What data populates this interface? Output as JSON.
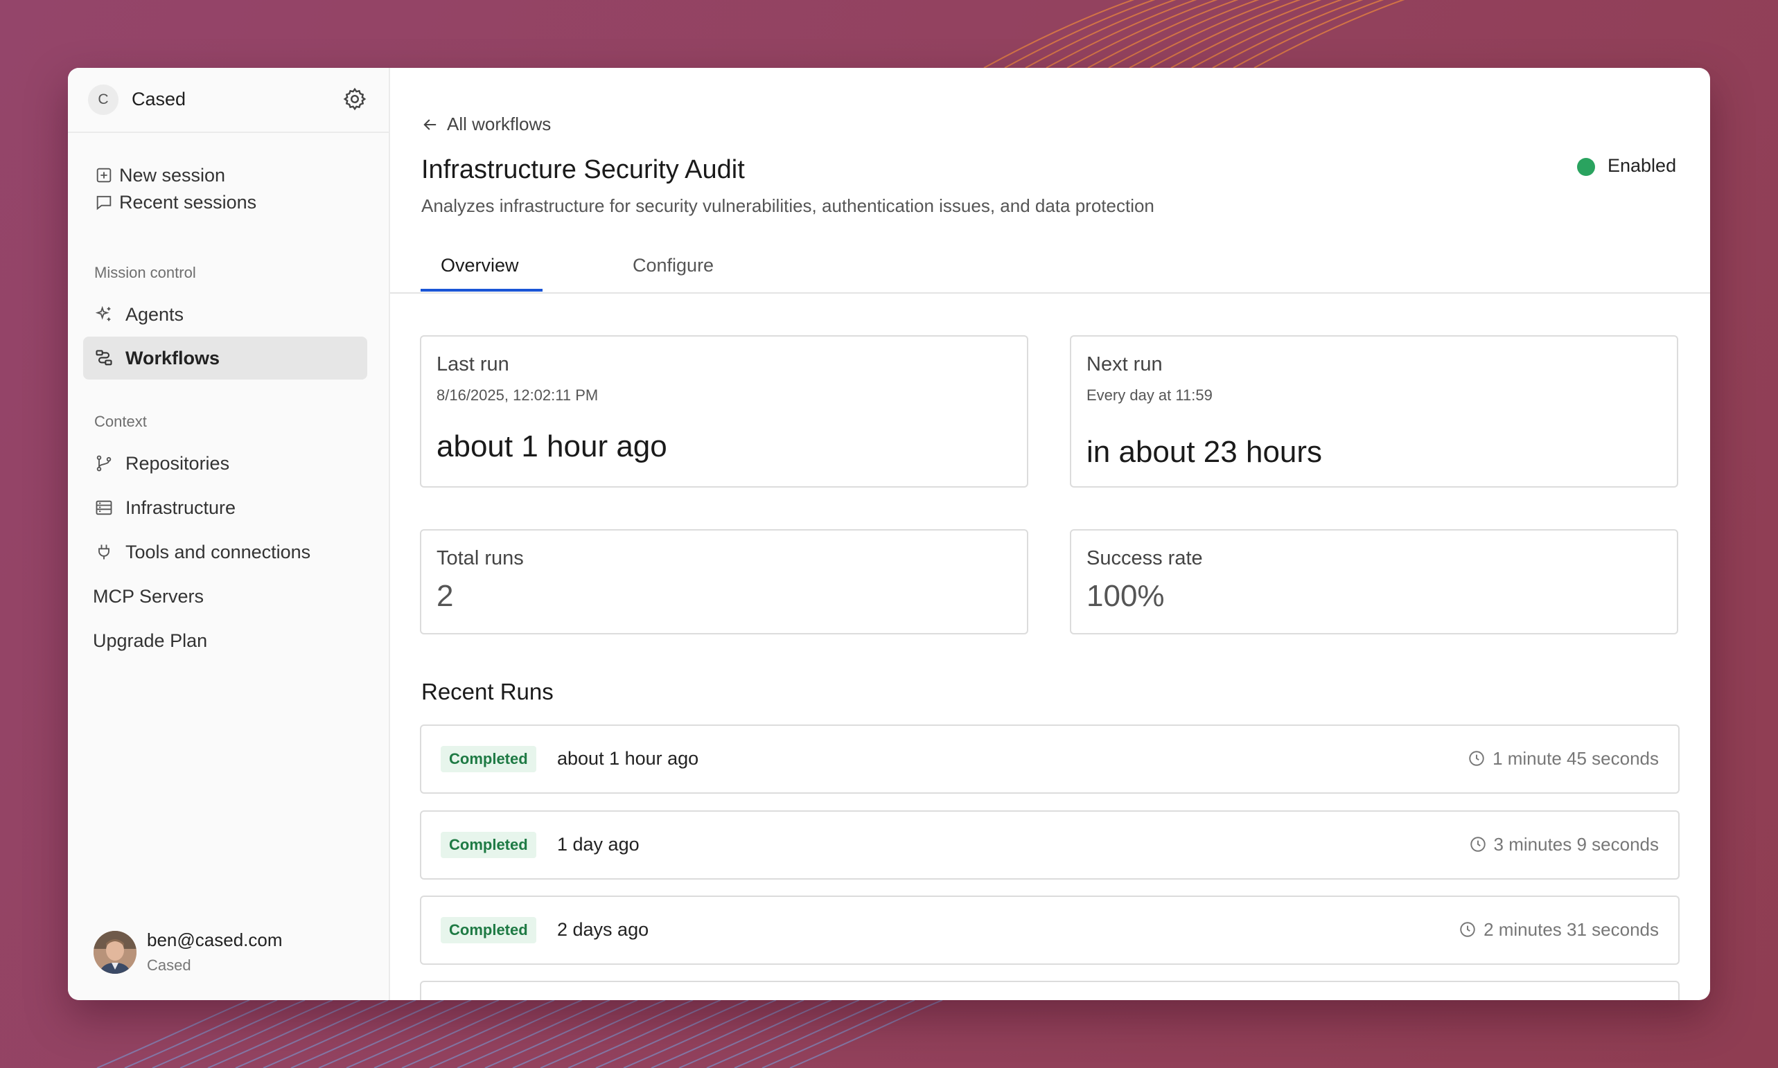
{
  "sidebar": {
    "org_initial": "C",
    "org_name": "Cased",
    "items": [
      {
        "label": "New session",
        "icon": "plus-square-icon"
      },
      {
        "label": "Recent sessions",
        "icon": "chat-bubble-icon"
      },
      {
        "label": "Agents",
        "icon": "sparkles-icon"
      },
      {
        "label": "Workflows",
        "icon": "workflow-icon"
      },
      {
        "label": "Repositories",
        "icon": "git-branch-icon"
      },
      {
        "label": "Infrastructure",
        "icon": "server-icon"
      },
      {
        "label": "Tools and connections",
        "icon": "plug-icon"
      },
      {
        "label": "MCP Servers"
      },
      {
        "label": "Upgrade Plan"
      }
    ],
    "sections": {
      "mission_control": "Mission control",
      "context": "Context"
    },
    "user": {
      "email": "ben@cased.com",
      "org": "Cased"
    }
  },
  "main": {
    "back_label": "All workflows",
    "title": "Infrastructure Security Audit",
    "description": "Analyzes infrastructure for security vulnerabilities, authentication issues, and data protection",
    "status": {
      "label": "Enabled",
      "color": "#2aa35f"
    },
    "tabs": [
      {
        "label": "Overview"
      },
      {
        "label": "Configure"
      }
    ],
    "cards": {
      "last_run": {
        "title": "Last run",
        "sub": "8/16/2025, 12:02:11 PM",
        "value": "about 1 hour ago"
      },
      "next_run": {
        "title": "Next run",
        "sub": "Every day at 11:59",
        "value": "in about 23 hours"
      },
      "total_runs": {
        "title": "Total runs",
        "value": "2"
      },
      "success_rate": {
        "title": "Success rate",
        "value": "100%"
      }
    },
    "recent_runs_title": "Recent Runs",
    "runs": [
      {
        "status": "Completed",
        "time": "about 1 hour ago",
        "duration": "1 minute 45 seconds"
      },
      {
        "status": "Completed",
        "time": "1 day ago",
        "duration": "3 minutes 9 seconds"
      },
      {
        "status": "Completed",
        "time": "2 days ago",
        "duration": "2 minutes 31 seconds"
      }
    ]
  }
}
